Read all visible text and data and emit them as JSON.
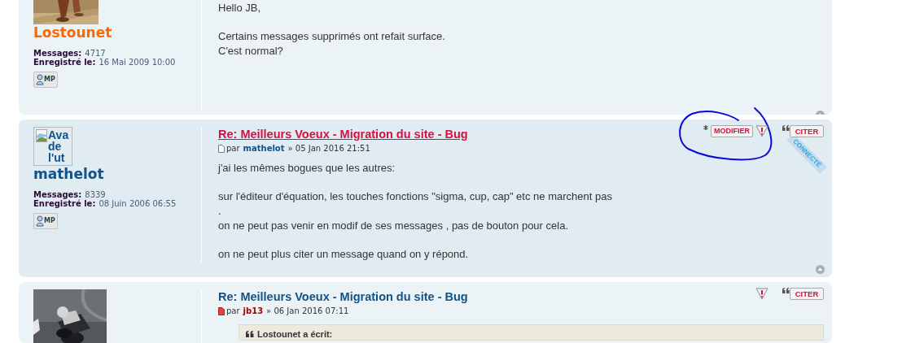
{
  "posts": [
    {
      "cut_top": true,
      "color": "#ecf3f7",
      "avatar": {
        "kind": "picture"
      },
      "author": {
        "name": "Lostounet",
        "color": "#ff6600"
      },
      "stats": [
        {
          "label": "Messages:",
          "value": "4717"
        },
        {
          "label": "Enregistré le:",
          "value": "16 Mai 2009 10:00"
        }
      ],
      "pm_button": "MP",
      "paragraphs": [
        [
          "Hello JB,"
        ],
        [
          "Certains messages supprimés ont refait surface.",
          "C'est normal?"
        ]
      ],
      "back_to_top": true
    },
    {
      "cut_top": false,
      "color": "#e1ebf2",
      "avatar": {
        "kind": "broken",
        "alt": "Ava de l'ut"
      },
      "author": {
        "name": "mathelot",
        "color": "#105289"
      },
      "stats": [
        {
          "label": "Messages:",
          "value": "8339"
        },
        {
          "label": "Enregistré le:",
          "value": "08 Juin 2006 06:55"
        }
      ],
      "pm_button": "MP",
      "title": "Re: Meilleurs Voeux - Migration du site - Bug",
      "highlighted": true,
      "meta": {
        "unread": false,
        "by": "par",
        "author": {
          "name": "mathelot",
          "color": "#105289"
        },
        "date": "» 05 Jan 2016 21:51"
      },
      "buttons": [
        {
          "kind": "edit",
          "label": "MODIFIER"
        },
        {
          "kind": "report"
        },
        {
          "kind": "quote",
          "label": "CITER"
        }
      ],
      "online_label": "CONNECTÉ",
      "paragraphs": [
        [
          "j'ai les mêmes bogues que les autres:"
        ],
        [
          "sur l'éditeur d'équation, les touches fonctions \"sigma, cup, cap\" etc ne marchent pas",
          ".",
          "on ne peut pas venir en modif de ses messages , pas de bouton pour cela."
        ],
        [
          "on ne peut plus citer un message quand on y répond."
        ]
      ],
      "back_to_top": true
    },
    {
      "cut_top": false,
      "color": "#ecf3f7",
      "avatar": {
        "kind": "picture"
      },
      "title": "Re: Meilleurs Voeux - Migration du site - Bug",
      "highlighted": false,
      "meta": {
        "unread": true,
        "by": "par",
        "author": {
          "name": "jb13",
          "color": "#aa0000"
        },
        "date": "» 06 Jan 2016 07:11"
      },
      "buttons": [
        {
          "kind": "report"
        },
        {
          "kind": "quote",
          "label": "CITER"
        }
      ],
      "quote": {
        "author_line": "Lostounet a écrit:"
      },
      "back_to_top": false
    }
  ],
  "annotation": {
    "kind": "hand-drawn-circle"
  }
}
